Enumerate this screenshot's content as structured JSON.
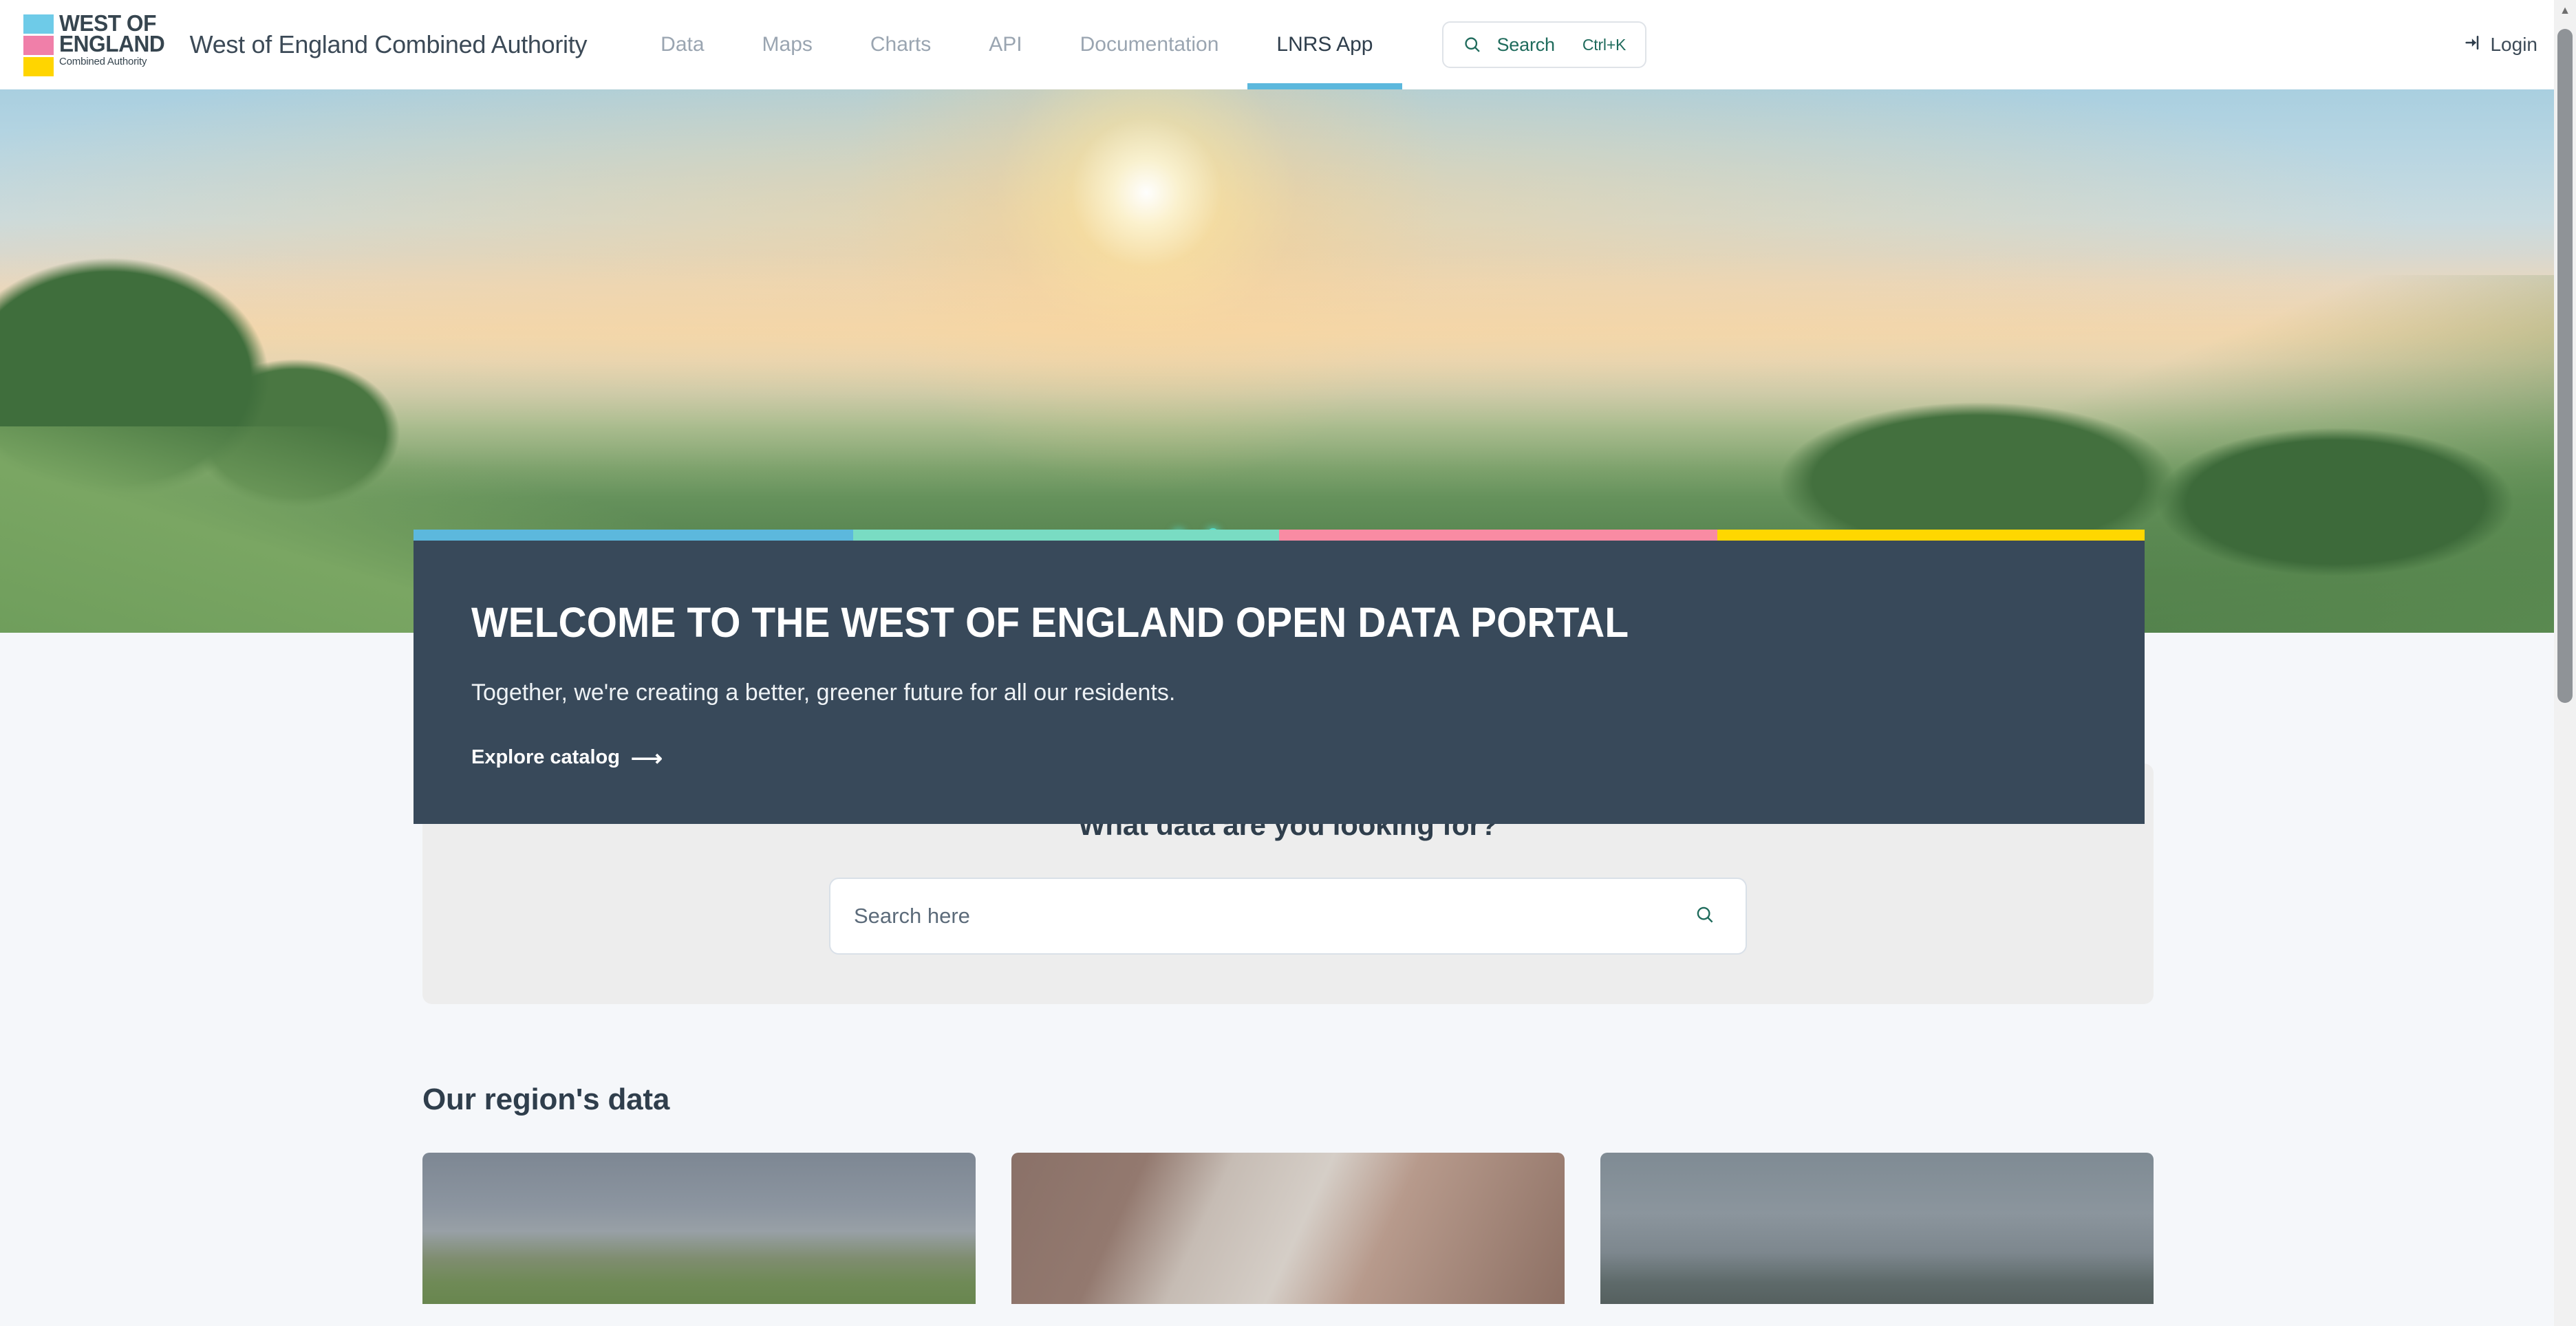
{
  "brand": {
    "logo_line1": "WEST OF",
    "logo_line2": "ENGLAND",
    "logo_line3": "Combined Authority",
    "title": "West of England Combined Authority",
    "swatch_colors": [
      "#6ecbe8",
      "#f07fa9",
      "#ffd500"
    ]
  },
  "nav": {
    "items": [
      {
        "label": "Data",
        "active": false
      },
      {
        "label": "Maps",
        "active": false
      },
      {
        "label": "Charts",
        "active": false
      },
      {
        "label": "API",
        "active": false
      },
      {
        "label": "Documentation",
        "active": false
      },
      {
        "label": "LNRS App",
        "active": true
      }
    ],
    "active_underline_color": "#5cb8dd",
    "search": {
      "label": "Search",
      "shortcut": "Ctrl+K",
      "icon": "search-icon",
      "text_color": "#1f6b5c"
    },
    "login": {
      "label": "Login",
      "icon": "login-arrow-icon"
    }
  },
  "hero": {
    "alt": "Sunset over rolling green hills and countryside",
    "accent_bar": {
      "segments": [
        "#5cb8dd",
        "#79dcc3",
        "#f98ba3",
        "#ffd700"
      ]
    },
    "card": {
      "title": "WELCOME TO THE WEST OF ENGLAND OPEN DATA PORTAL",
      "subtitle": "Together, we're creating a better, greener future for all our residents.",
      "cta_label": "Explore catalog",
      "cta_arrow": "⟶",
      "background": "#38495a"
    }
  },
  "search_section": {
    "heading": "What data are you looking for?",
    "input_value": "",
    "input_placeholder": "Search here",
    "submit_icon": "search-icon",
    "panel_background": "#ededed"
  },
  "region_section": {
    "title": "Our region's data",
    "cards": [
      {
        "name": "countryside-field-card"
      },
      {
        "name": "hands-paper-card"
      },
      {
        "name": "construction-crane-card"
      }
    ]
  },
  "scrollbar": {
    "up_arrow": "▲",
    "position": "right"
  }
}
